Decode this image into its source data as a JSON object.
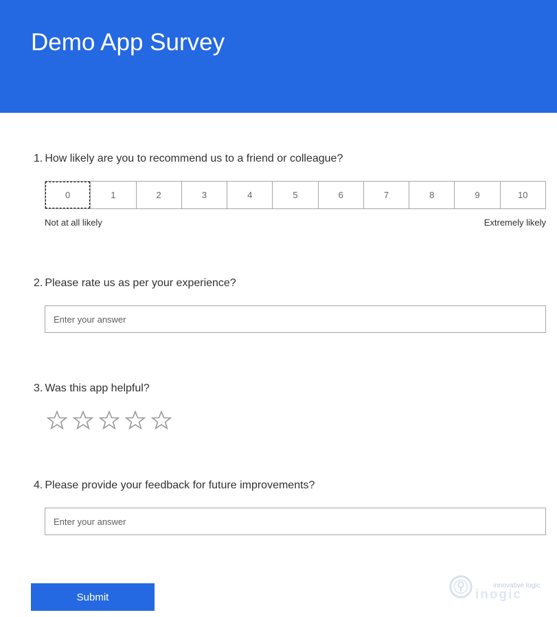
{
  "header": {
    "title": "Demo App Survey",
    "background_color": "#2468e2"
  },
  "questions": [
    {
      "number": "1.",
      "text": "How likely are you to recommend us to a friend or colleague?",
      "type": "nps",
      "options": [
        "0",
        "1",
        "2",
        "3",
        "4",
        "5",
        "6",
        "7",
        "8",
        "9",
        "10"
      ],
      "focused_option": "0",
      "low_label": "Not at all likely",
      "high_label": "Extremely likely"
    },
    {
      "number": "2.",
      "text": "Please rate us as per your experience?",
      "type": "text",
      "value": "",
      "placeholder": "Enter your answer"
    },
    {
      "number": "3.",
      "text": "Was this app helpful?",
      "type": "rating",
      "max_stars": 5,
      "value": 0,
      "icon": "star-outline-icon"
    },
    {
      "number": "4.",
      "text": "Please provide your feedback for future improvements?",
      "type": "text",
      "value": "",
      "placeholder": "Enter your answer"
    }
  ],
  "submit": {
    "label": "Submit"
  },
  "watermark": {
    "tagline": "innovative logic",
    "brand": "inogic"
  }
}
